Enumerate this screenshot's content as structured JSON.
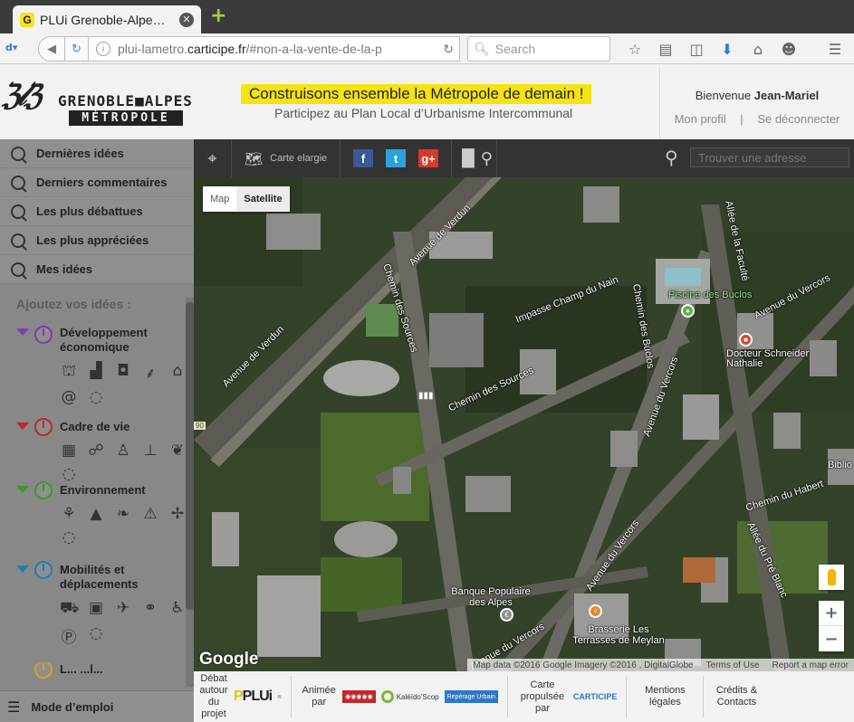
{
  "browser": {
    "tab_title": "PLUi Grenoble-Alpe…",
    "tab_favicon": "G",
    "url_prefix": "plui-lametro.",
    "url_domain": "carticipe.fr",
    "url_path": "/#non-a-la-vente-de-la-p",
    "search_placeholder": "Search"
  },
  "header": {
    "logo_top": "GRENOBLE■ALPES",
    "logo_bottom": "MÉTROPOLE",
    "headline": "Construisons ensemble la Métropole de demain !",
    "subline": "Participez au Plan Local d’Urbanisme Intercommunal",
    "welcome_prefix": "Bienvenue ",
    "user_name": "Jean-Mariel",
    "profile_link": "Mon profil",
    "separator": "|",
    "logout_link": "Se déconnecter"
  },
  "sidebar": {
    "items": [
      {
        "label": "Dernières idées"
      },
      {
        "label": "Derniers commentaires"
      },
      {
        "label": "Les plus débattues"
      },
      {
        "label": "Les plus appréciées"
      },
      {
        "label": "Mes idées"
      }
    ],
    "add_title": "Ajoutez vos idées :",
    "categories": [
      {
        "label": "Développement économique",
        "color": "#7b3fb0"
      },
      {
        "label": "Cadre de vie",
        "color": "#c0282a"
      },
      {
        "label": "Environnement",
        "color": "#3c9a2a"
      },
      {
        "label": "Mobilités et déplacements",
        "color": "#1f7fb0"
      }
    ],
    "next_category_partial": "L... ...l...",
    "mode_emploi": "Mode d’emploi"
  },
  "toolbar": {
    "carte_label": "Carte elargie",
    "search_placeholder": "Trouver une adresse",
    "social": {
      "fb": "f",
      "tw": "t",
      "gp": "g+"
    }
  },
  "map": {
    "type_map": "Map",
    "type_satellite": "Satellite",
    "labels": {
      "verdun1": "Avenue de Verdun",
      "verdun2": "Avenue de Verdun",
      "sources1": "Chemin des Sources",
      "sources2": "Chemin des Sources",
      "impasse": "Impasse Champ du Nain",
      "buclos_ch": "Chemin des Buclos",
      "faculte": "Allée de la Faculté",
      "piscine": "Piscine des Buclos",
      "docteur": "Docteur Schneider Nathalie",
      "vercors1": "Avenue du Vercors",
      "vercors2": "Avenue du Vercors",
      "vercors3": "Avenue du Vercors",
      "vercors4": "Avenue du Vercors",
      "habert": "Chemin du Habert",
      "prebenit": "Allée du Pré Blanc",
      "biblio": "Biblio",
      "banque": "Banque Populaire des Alpes",
      "brasserie": "Brasserie Les Terrasses de Meylan",
      "route90": "90"
    },
    "google": "Google",
    "attribution": "Map data ©2016 Google Imagery ©2016 , DigitalGlobe",
    "terms": "Terms of Use",
    "report": "Report a map error"
  },
  "footer": {
    "debat": "Débat autour du projet",
    "plui": "PLUi",
    "animee": "Animée par",
    "kaleido": "Kaléïdo'Scop",
    "repere": "Repérage Urbain",
    "carte": "Carte propulsée par",
    "carticipe": "CARTICIPE",
    "mentions": "Mentions légales",
    "credits": "Crédits & Contacts"
  }
}
